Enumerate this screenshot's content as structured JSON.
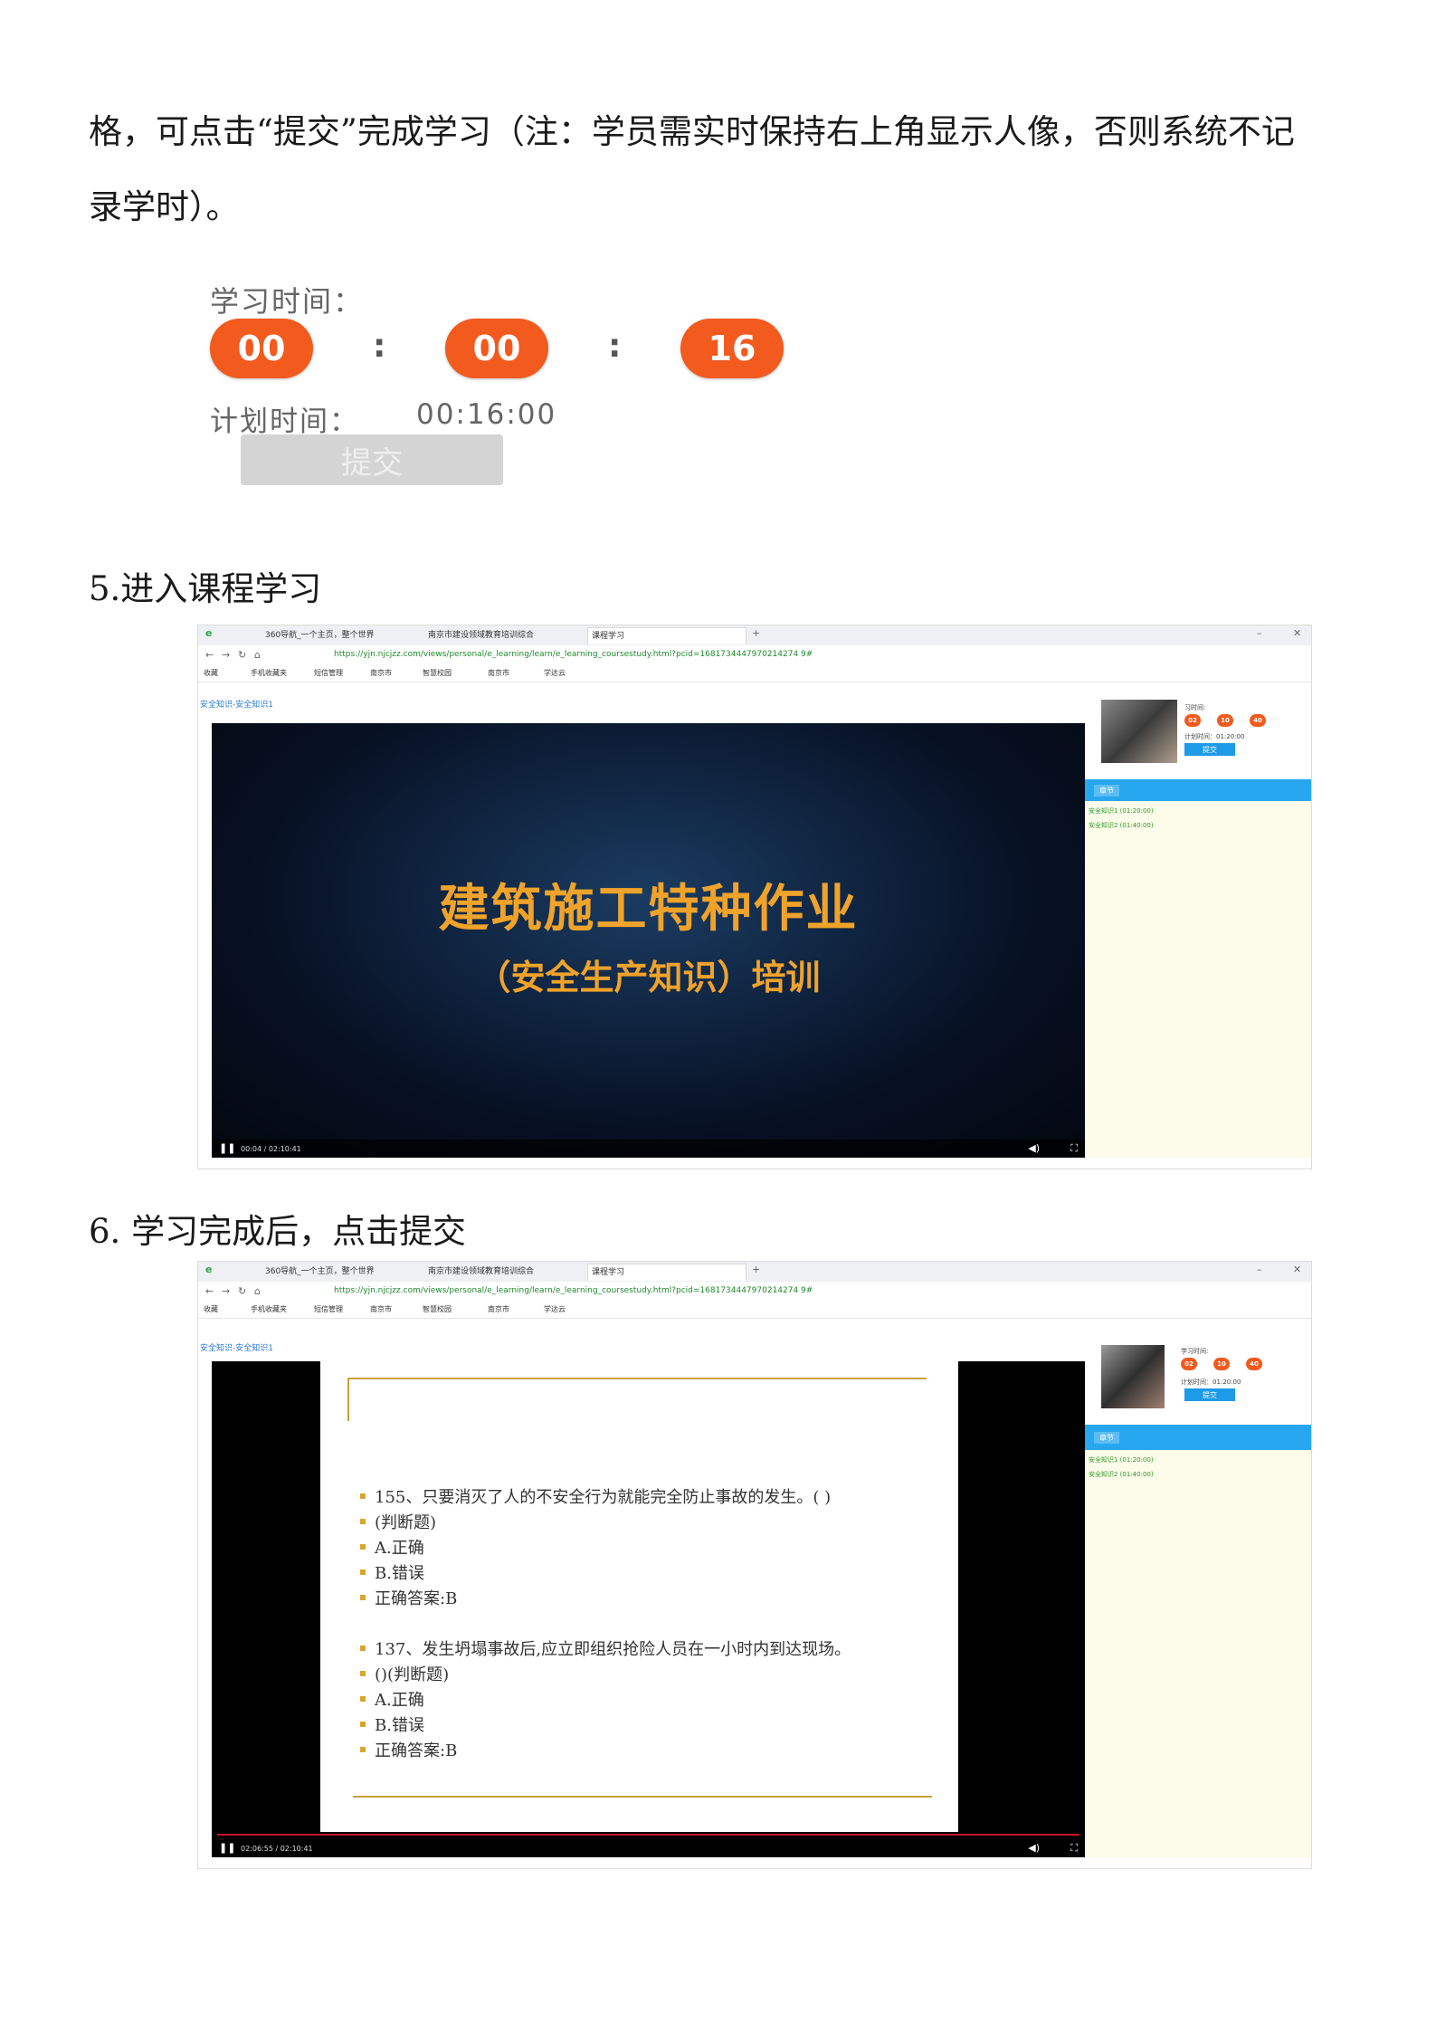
{
  "intro": {
    "line1": "格，可点击“提交”完成学习（注：学员需实时保持右上角显示人像，否则系统不记",
    "line2": "录学时）。"
  },
  "timer": {
    "label": "学习时间：",
    "hours": "00",
    "minutes": "00",
    "seconds": "16",
    "plan_label": "计划时间：",
    "plan_value": "00:16:00",
    "submit_label": "提交"
  },
  "step5": {
    "heading": "5.进入课程学习"
  },
  "step6": {
    "heading": "6. 学习完成后，点击提交"
  },
  "browser": {
    "tab1": "360导航_一个主页，整个世界",
    "tab2": "南京市建设领域教育培训综合",
    "tab3": "课程学习",
    "url": "https://yjn.njcjzz.com/views/personal/e_learning/learn/e_learning_coursestudy.html?pcid=1681734447970214274 9#",
    "bookmarks": [
      "收藏",
      "手机收藏夹",
      "短信管理",
      "南京市",
      "智慧校园",
      "南京市",
      "学达云"
    ]
  },
  "shot1": {
    "breadcrumb": "安全知识-安全知识1",
    "title_main": "建筑施工特种作业",
    "title_sub": "（安全生产知识）培训",
    "time": "00:04 / 02:10:41",
    "side_label": "习时间:",
    "pills": [
      "02",
      "10",
      "40"
    ],
    "plan": "计划时间：01:20:00",
    "submit": "提交",
    "section": "章节",
    "lessons": [
      "安全知识1 (01:20:00)",
      "安全知识2 (01:40:00)"
    ]
  },
  "shot2": {
    "breadcrumb": "安全知识-安全知识1",
    "time": "02:06:55 / 02:10:41",
    "side_label": "学习时间:",
    "pills": [
      "02",
      "10",
      "40"
    ],
    "plan": "计划时间：01:20:00",
    "submit": "提交",
    "section": "章节",
    "lessons": [
      "安全知识1 (01:20:00)",
      "安全知识2 (01:40:00)"
    ],
    "slide": [
      "155、只要消灭了人的不安全行为就能完全防止事故的发生。(    )",
      "(判断题)",
      "A.正确",
      "B.错误",
      "正确答案:B",
      "137、发生坍塌事故后,应立即组织抢险人员在一小时内到达现场。",
      "()(判断题)",
      "A.正确",
      "B.错误",
      "正确答案:B"
    ]
  }
}
